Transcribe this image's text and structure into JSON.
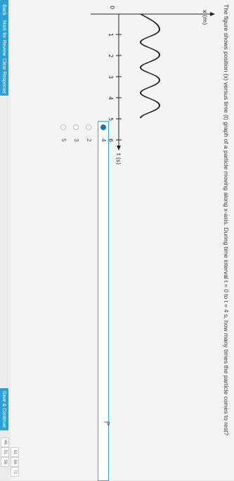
{
  "question": {
    "text": "The figure shows position (x) versus time (t) graph of a particle moving along x-axis. During time interval t = 0 to t = 4 s, how many times the particle comes to rest?"
  },
  "graph": {
    "y_label": "x (m)",
    "x_label": "t (s)",
    "origin_label": "0",
    "ticks": [
      "1",
      "2",
      "3",
      "4",
      "5",
      "6"
    ]
  },
  "options": [
    {
      "label": "4",
      "selected": true
    },
    {
      "label": "2",
      "selected": false
    },
    {
      "label": "3",
      "selected": false
    },
    {
      "label": "5",
      "selected": false
    }
  ],
  "buttons": {
    "back": "Back",
    "mark_review": "Mark for Review",
    "clear_response": "Clear Response",
    "save_continue": "Save & Continue"
  },
  "page_numbers": [
    "46",
    "51",
    "56",
    "61",
    "66",
    "71"
  ],
  "colors": {
    "accent": "#2aa0d4",
    "selected": "#1e73be"
  },
  "icons": {
    "flag": "flag-icon"
  }
}
